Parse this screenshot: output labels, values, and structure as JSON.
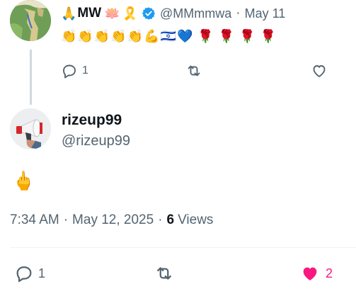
{
  "parent_tweet": {
    "display_name": "MW",
    "name_emojis_before": [
      "🙏"
    ],
    "name_emojis_after": [
      "🪷",
      "🎗️"
    ],
    "verified": true,
    "handle": "@MMmmwa",
    "separator": "·",
    "date": "May 11",
    "content_emojis": [
      "👏",
      "👏",
      "👏",
      "👏",
      "👏",
      "💪",
      "🇮🇱",
      "💙",
      "🌹",
      "🌹",
      "🌹",
      "🌹"
    ],
    "replies": "1"
  },
  "reply_tweet": {
    "display_name": "rizeup99",
    "handle": "@rizeup99",
    "body": "🖕",
    "time": "7:34 AM",
    "date": "May 12, 2025",
    "separator": "·",
    "views_count": "6",
    "views_label": "Views",
    "replies": "1",
    "likes": "2"
  },
  "colors": {
    "text": "#0f1419",
    "secondary": "#536471",
    "verified": "#1d9bf0",
    "like_active": "#f91880",
    "thread_line": "#cfd9de"
  },
  "icons": {
    "reply": "reply-icon",
    "retweet": "retweet-icon",
    "like": "heart-icon",
    "verified": "verified-badge-icon"
  }
}
